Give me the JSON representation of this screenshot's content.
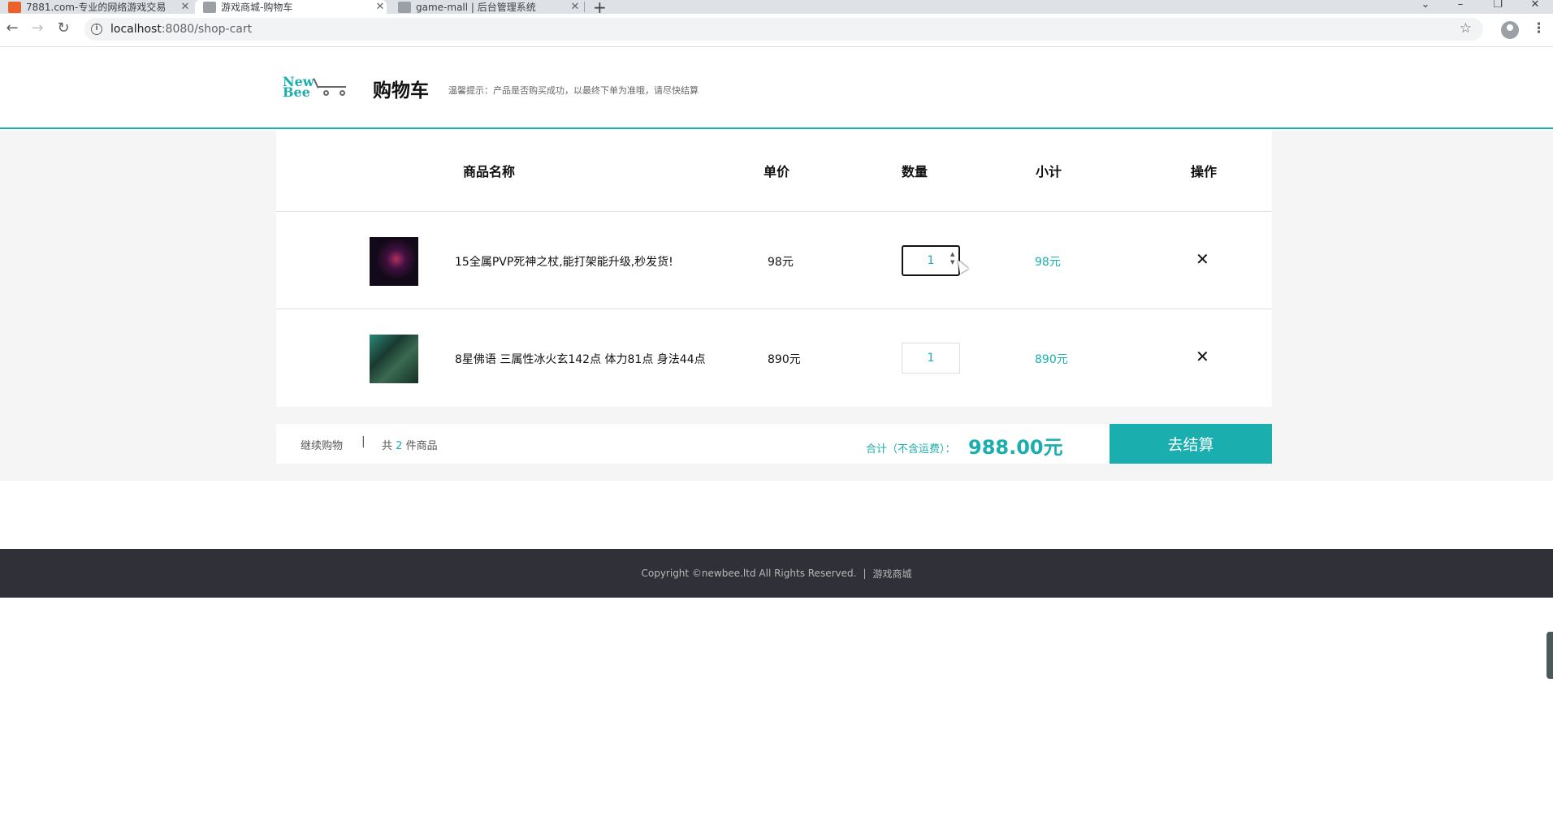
{
  "browser": {
    "tabs": [
      {
        "title": "7881.com-专业的网络游戏交易",
        "active": false
      },
      {
        "title": "游戏商城-购物车",
        "active": true
      },
      {
        "title": "game-mall | 后台管理系统",
        "active": false
      }
    ],
    "url_host": "localhost",
    "url_path": ":8080/shop-cart"
  },
  "header": {
    "logo_text_top": "New",
    "logo_text_bottom": "Bee",
    "title": "购物车",
    "tip": "温馨提示：产品是否购买成功，以最终下单为准哦，请尽快结算"
  },
  "table": {
    "columns": {
      "name": "商品名称",
      "price": "单价",
      "quantity": "数量",
      "subtotal": "小计",
      "action": "操作"
    },
    "items": [
      {
        "name": "15全属PVP死神之杖,能打架能升级,秒发货!",
        "price": "98元",
        "quantity": "1",
        "subtotal": "98元"
      },
      {
        "name": "8星佛语 三属性冰火玄142点 体力81点 身法44点",
        "price": "890元",
        "quantity": "1",
        "subtotal": "890元"
      }
    ],
    "delete_glyph": "✕"
  },
  "summary": {
    "continue_label": "继续购物",
    "separator": "|",
    "count_prefix": "共",
    "count": "2",
    "count_suffix": "件商品",
    "total_label": "合计（不含运费）：",
    "total_value": "988.00元",
    "checkout_label": "去结算"
  },
  "footer": {
    "copyright": "Copyright ©newbee.ltd All Rights Reserved.",
    "separator": "|",
    "link": "游戏商城"
  },
  "colors": {
    "accent": "#1baeae",
    "footer_bg": "#2f3038",
    "page_bg": "#f5f5f5"
  }
}
